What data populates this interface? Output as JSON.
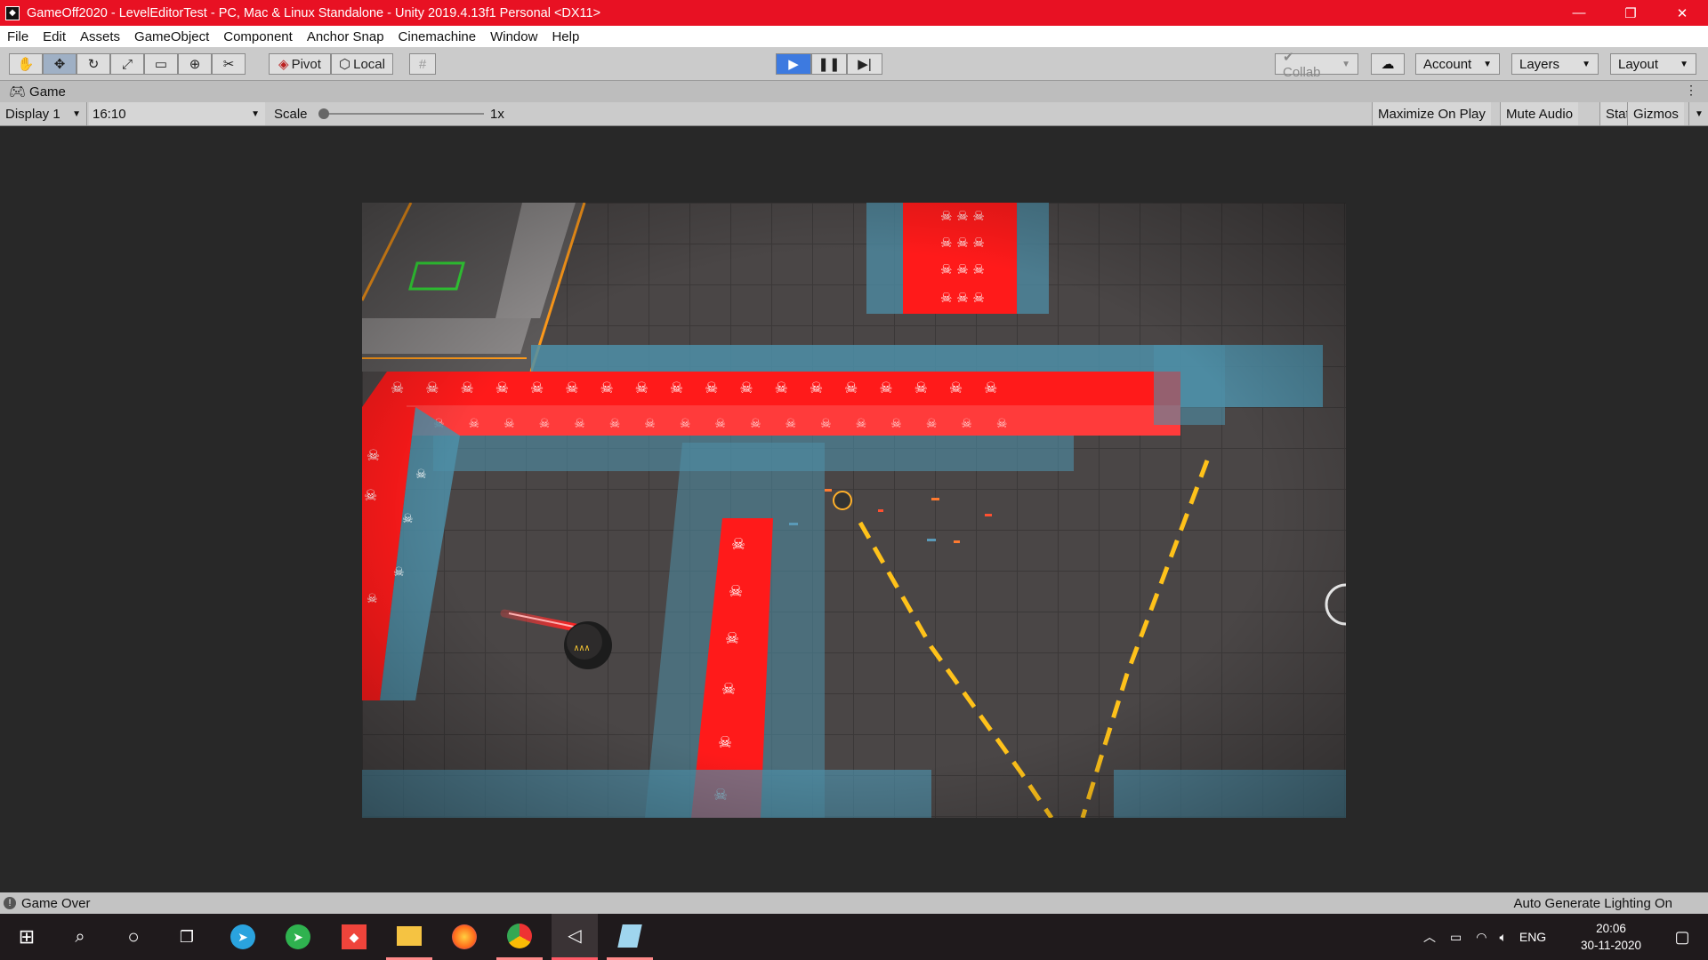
{
  "window": {
    "title": "GameOff2020 - LevelEditorTest - PC, Mac & Linux Standalone - Unity 2019.4.13f1 Personal <DX11>",
    "controls": [
      "—",
      "❐",
      "✕"
    ]
  },
  "menu": [
    "File",
    "Edit",
    "Assets",
    "GameObject",
    "Component",
    "Anchor Snap",
    "Cinemachine",
    "Window",
    "Help"
  ],
  "toolbar": {
    "tools": [
      "hand-icon",
      "move-icon",
      "rotate-icon",
      "scale-icon",
      "rect-icon",
      "transform-icon",
      "custom-tool-icon"
    ],
    "pivot_label": "Pivot",
    "local_label": "Local",
    "collab_label": "Collab",
    "account_label": "Account",
    "layers_label": "Layers",
    "layout_label": "Layout"
  },
  "tab": {
    "label": "Game"
  },
  "game_bar": {
    "display": "Display 1",
    "aspect": "16:10",
    "scale_label": "Scale",
    "scale_value": "1x",
    "scale_fraction": 0.0,
    "maximize_label": "Maximize On Play",
    "mute_label": "Mute Audio",
    "stats_label": "Stats",
    "gizmos_label": "Gizmos"
  },
  "status": {
    "message": "Game Over",
    "right": "Auto Generate Lighting On"
  },
  "taskbar": {
    "apps": [
      "start-icon",
      "search-icon",
      "cortana-icon",
      "task-view-icon",
      "telegram-icon",
      "airdroid-icon",
      "anydesk-icon",
      "file-explorer-icon",
      "firefox-icon",
      "chrome-icon",
      "unity-icon",
      "notepad-icon"
    ],
    "language": "ENG",
    "time": "20:06",
    "date": "30-11-2020"
  },
  "colors": {
    "titlebar": "#e81123",
    "hazard_red": "#ff1a1a",
    "wall_blue": "#4e8fa8",
    "floor": "#4a4646",
    "laser_yellow": "#ffc21a"
  }
}
